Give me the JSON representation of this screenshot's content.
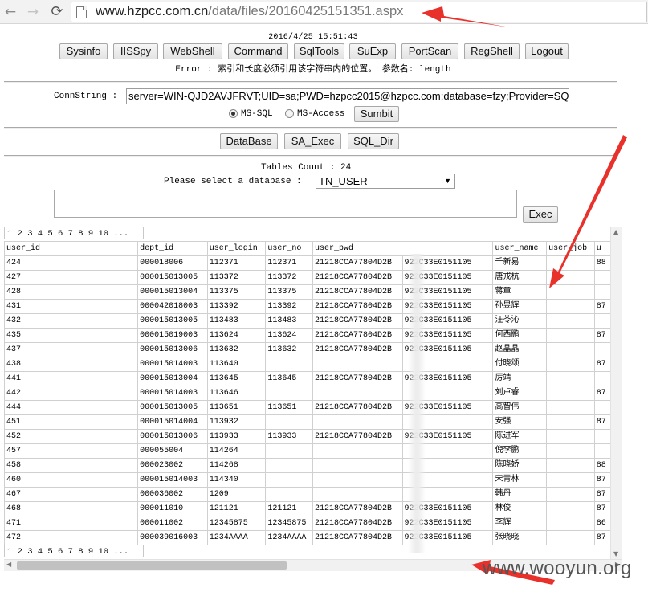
{
  "browser": {
    "nav": {
      "back": "←",
      "forward": "→",
      "reload": "⟳"
    },
    "url_host": "www.hzpcc.com.cn",
    "url_path": "/data/files/20160425151351.aspx"
  },
  "header": {
    "timestamp": "2016/4/25 15:51:43",
    "toolbar": [
      "Sysinfo",
      "IISSpy",
      "WebShell",
      "Command",
      "SqlTools",
      "SuExp",
      "PortScan",
      "RegShell",
      "Logout"
    ],
    "error_message": "Error : 索引和长度必须引用该字符串内的位置。 参数名: length"
  },
  "conn": {
    "label": "ConnString :",
    "value": "server=WIN-QJD2AVJFRVT;UID=sa;PWD=hzpcc2015@hzpcc.com;database=fzy;Provider=SQLOLEDB",
    "options": [
      "MS-SQL",
      "MS-Access"
    ],
    "selected": "MS-SQL",
    "submit_label": "Sumbit"
  },
  "db_tools": [
    "DataBase",
    "SA_Exec",
    "SQL_Dir"
  ],
  "tables": {
    "count_text": "Tables Count : 24",
    "select_label": "Please select a database :",
    "selected_table": "TN_USER",
    "exec_label": "Exec"
  },
  "grid": {
    "pager": "1 2 3 4 5 6 7 8 9 10 ...",
    "columns": [
      "user_id",
      "dept_id",
      "user_login",
      "user_no",
      "user_pwd",
      "user_name",
      "user_job",
      "u"
    ],
    "rows": [
      [
        "424",
        "000018006",
        "112371",
        "112371",
        "21218CCA77804D2B",
        "922C33E0151105",
        "千新易",
        "",
        "88"
      ],
      [
        "427",
        "000015013005",
        "113372",
        "113372",
        "21218CCA77804D2B",
        "922C33E0151105",
        "唐戎杭",
        "",
        ""
      ],
      [
        "428",
        "000015013004",
        "113375",
        "113375",
        "21218CCA77804D2B",
        "922C33E0151105",
        "蒋章",
        "",
        ""
      ],
      [
        "431",
        "000042018003",
        "113392",
        "113392",
        "21218CCA77804D2B",
        "922C33E0151105",
        "孙昱辉",
        "",
        "87"
      ],
      [
        "432",
        "000015013005",
        "113483",
        "113483",
        "21218CCA77804D2B",
        "922C33E0151105",
        "汪苓沁",
        "",
        ""
      ],
      [
        "435",
        "000015019003",
        "113624",
        "113624",
        "21218CCA77804D2B",
        "922C33E0151105",
        "何西鹏",
        "",
        "87"
      ],
      [
        "437",
        "000015013006",
        "113632",
        "113632",
        "21218CCA77804D2B",
        "922C33E0151105",
        "赵晶晶",
        "",
        ""
      ],
      [
        "438",
        "000015014003",
        "113640",
        "",
        "",
        "",
        "付晓颂",
        "",
        "87"
      ],
      [
        "441",
        "000015013004",
        "113645",
        "113645",
        "21218CCA77804D2B",
        "922C33E0151105",
        "厉靖",
        "",
        ""
      ],
      [
        "442",
        "000015014003",
        "113646",
        "",
        "",
        "",
        "刘卢睿",
        "",
        "87"
      ],
      [
        "444",
        "000015013005",
        "113651",
        "113651",
        "21218CCA77804D2B",
        "922C33E0151105",
        "高智伟",
        "",
        ""
      ],
      [
        "451",
        "000015014004",
        "113932",
        "",
        "",
        "",
        "安强",
        "",
        "87"
      ],
      [
        "452",
        "000015013006",
        "113933",
        "113933",
        "21218CCA77804D2B",
        "922C33E0151105",
        "陈进军",
        "",
        ""
      ],
      [
        "457",
        "000055004",
        "114264",
        "",
        "",
        "",
        "倪李鹏",
        "",
        ""
      ],
      [
        "458",
        "000023002",
        "114268",
        "",
        "",
        "",
        "陈晓娇",
        "",
        "88"
      ],
      [
        "460",
        "000015014003",
        "114340",
        "",
        "",
        "",
        "宋青林",
        "",
        "87"
      ],
      [
        "467",
        "000036002",
        "1209",
        "",
        "",
        "",
        "韩丹",
        "",
        "87"
      ],
      [
        "468",
        "000011010",
        "121121",
        "121121",
        "21218CCA77804D2B",
        "922C33E0151105",
        "林俊",
        "",
        "87"
      ],
      [
        "471",
        "000011002",
        "12345875",
        "12345875",
        "21218CCA77804D2B",
        "922C33E0151105",
        "李辉",
        "",
        "86"
      ],
      [
        "472",
        "000039016003",
        "1234AAAA",
        "1234AAAA",
        "21218CCA77804D2B",
        "922C33E0151105",
        "张晓晓",
        "",
        "87"
      ]
    ]
  },
  "watermark": "www.wooyun.org",
  "colors": {
    "annotation_arrow": "#e8312b",
    "button_border": "#a7a7a7",
    "grid_border": "#d0d0d0"
  }
}
